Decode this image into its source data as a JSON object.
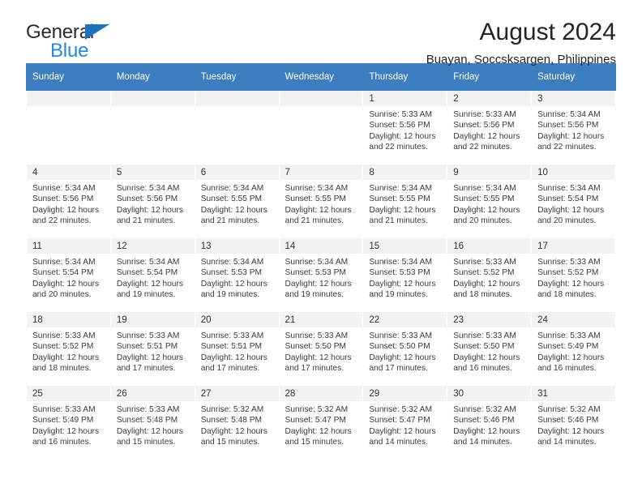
{
  "brand": {
    "name_part1": "General",
    "name_part2": "Blue",
    "triangle_color": "#1f72bd",
    "text_color": "#2b2b2b",
    "blue_color": "#2489d6"
  },
  "header": {
    "title": "August 2024",
    "subtitle": "Buayan, Soccsksargen, Philippines"
  },
  "colors": {
    "header_row": "#3c7ebf",
    "daynum_band": "#f2f2f2",
    "cell_bg": "#ffffff",
    "text": "#3a3a3a"
  },
  "weekday_headers": [
    "Sunday",
    "Monday",
    "Tuesday",
    "Wednesday",
    "Thursday",
    "Friday",
    "Saturday"
  ],
  "weeks": [
    [
      {
        "day": "",
        "sunrise": "",
        "sunset": "",
        "daylight": ""
      },
      {
        "day": "",
        "sunrise": "",
        "sunset": "",
        "daylight": ""
      },
      {
        "day": "",
        "sunrise": "",
        "sunset": "",
        "daylight": ""
      },
      {
        "day": "",
        "sunrise": "",
        "sunset": "",
        "daylight": ""
      },
      {
        "day": "1",
        "sunrise": "Sunrise: 5:33 AM",
        "sunset": "Sunset: 5:56 PM",
        "daylight": "Daylight: 12 hours and 22 minutes."
      },
      {
        "day": "2",
        "sunrise": "Sunrise: 5:33 AM",
        "sunset": "Sunset: 5:56 PM",
        "daylight": "Daylight: 12 hours and 22 minutes."
      },
      {
        "day": "3",
        "sunrise": "Sunrise: 5:34 AM",
        "sunset": "Sunset: 5:56 PM",
        "daylight": "Daylight: 12 hours and 22 minutes."
      }
    ],
    [
      {
        "day": "4",
        "sunrise": "Sunrise: 5:34 AM",
        "sunset": "Sunset: 5:56 PM",
        "daylight": "Daylight: 12 hours and 22 minutes."
      },
      {
        "day": "5",
        "sunrise": "Sunrise: 5:34 AM",
        "sunset": "Sunset: 5:56 PM",
        "daylight": "Daylight: 12 hours and 21 minutes."
      },
      {
        "day": "6",
        "sunrise": "Sunrise: 5:34 AM",
        "sunset": "Sunset: 5:55 PM",
        "daylight": "Daylight: 12 hours and 21 minutes."
      },
      {
        "day": "7",
        "sunrise": "Sunrise: 5:34 AM",
        "sunset": "Sunset: 5:55 PM",
        "daylight": "Daylight: 12 hours and 21 minutes."
      },
      {
        "day": "8",
        "sunrise": "Sunrise: 5:34 AM",
        "sunset": "Sunset: 5:55 PM",
        "daylight": "Daylight: 12 hours and 21 minutes."
      },
      {
        "day": "9",
        "sunrise": "Sunrise: 5:34 AM",
        "sunset": "Sunset: 5:55 PM",
        "daylight": "Daylight: 12 hours and 20 minutes."
      },
      {
        "day": "10",
        "sunrise": "Sunrise: 5:34 AM",
        "sunset": "Sunset: 5:54 PM",
        "daylight": "Daylight: 12 hours and 20 minutes."
      }
    ],
    [
      {
        "day": "11",
        "sunrise": "Sunrise: 5:34 AM",
        "sunset": "Sunset: 5:54 PM",
        "daylight": "Daylight: 12 hours and 20 minutes."
      },
      {
        "day": "12",
        "sunrise": "Sunrise: 5:34 AM",
        "sunset": "Sunset: 5:54 PM",
        "daylight": "Daylight: 12 hours and 19 minutes."
      },
      {
        "day": "13",
        "sunrise": "Sunrise: 5:34 AM",
        "sunset": "Sunset: 5:53 PM",
        "daylight": "Daylight: 12 hours and 19 minutes."
      },
      {
        "day": "14",
        "sunrise": "Sunrise: 5:34 AM",
        "sunset": "Sunset: 5:53 PM",
        "daylight": "Daylight: 12 hours and 19 minutes."
      },
      {
        "day": "15",
        "sunrise": "Sunrise: 5:34 AM",
        "sunset": "Sunset: 5:53 PM",
        "daylight": "Daylight: 12 hours and 19 minutes."
      },
      {
        "day": "16",
        "sunrise": "Sunrise: 5:33 AM",
        "sunset": "Sunset: 5:52 PM",
        "daylight": "Daylight: 12 hours and 18 minutes."
      },
      {
        "day": "17",
        "sunrise": "Sunrise: 5:33 AM",
        "sunset": "Sunset: 5:52 PM",
        "daylight": "Daylight: 12 hours and 18 minutes."
      }
    ],
    [
      {
        "day": "18",
        "sunrise": "Sunrise: 5:33 AM",
        "sunset": "Sunset: 5:52 PM",
        "daylight": "Daylight: 12 hours and 18 minutes."
      },
      {
        "day": "19",
        "sunrise": "Sunrise: 5:33 AM",
        "sunset": "Sunset: 5:51 PM",
        "daylight": "Daylight: 12 hours and 17 minutes."
      },
      {
        "day": "20",
        "sunrise": "Sunrise: 5:33 AM",
        "sunset": "Sunset: 5:51 PM",
        "daylight": "Daylight: 12 hours and 17 minutes."
      },
      {
        "day": "21",
        "sunrise": "Sunrise: 5:33 AM",
        "sunset": "Sunset: 5:50 PM",
        "daylight": "Daylight: 12 hours and 17 minutes."
      },
      {
        "day": "22",
        "sunrise": "Sunrise: 5:33 AM",
        "sunset": "Sunset: 5:50 PM",
        "daylight": "Daylight: 12 hours and 17 minutes."
      },
      {
        "day": "23",
        "sunrise": "Sunrise: 5:33 AM",
        "sunset": "Sunset: 5:50 PM",
        "daylight": "Daylight: 12 hours and 16 minutes."
      },
      {
        "day": "24",
        "sunrise": "Sunrise: 5:33 AM",
        "sunset": "Sunset: 5:49 PM",
        "daylight": "Daylight: 12 hours and 16 minutes."
      }
    ],
    [
      {
        "day": "25",
        "sunrise": "Sunrise: 5:33 AM",
        "sunset": "Sunset: 5:49 PM",
        "daylight": "Daylight: 12 hours and 16 minutes."
      },
      {
        "day": "26",
        "sunrise": "Sunrise: 5:33 AM",
        "sunset": "Sunset: 5:48 PM",
        "daylight": "Daylight: 12 hours and 15 minutes."
      },
      {
        "day": "27",
        "sunrise": "Sunrise: 5:32 AM",
        "sunset": "Sunset: 5:48 PM",
        "daylight": "Daylight: 12 hours and 15 minutes."
      },
      {
        "day": "28",
        "sunrise": "Sunrise: 5:32 AM",
        "sunset": "Sunset: 5:47 PM",
        "daylight": "Daylight: 12 hours and 15 minutes."
      },
      {
        "day": "29",
        "sunrise": "Sunrise: 5:32 AM",
        "sunset": "Sunset: 5:47 PM",
        "daylight": "Daylight: 12 hours and 14 minutes."
      },
      {
        "day": "30",
        "sunrise": "Sunrise: 5:32 AM",
        "sunset": "Sunset: 5:46 PM",
        "daylight": "Daylight: 12 hours and 14 minutes."
      },
      {
        "day": "31",
        "sunrise": "Sunrise: 5:32 AM",
        "sunset": "Sunset: 5:46 PM",
        "daylight": "Daylight: 12 hours and 14 minutes."
      }
    ]
  ]
}
